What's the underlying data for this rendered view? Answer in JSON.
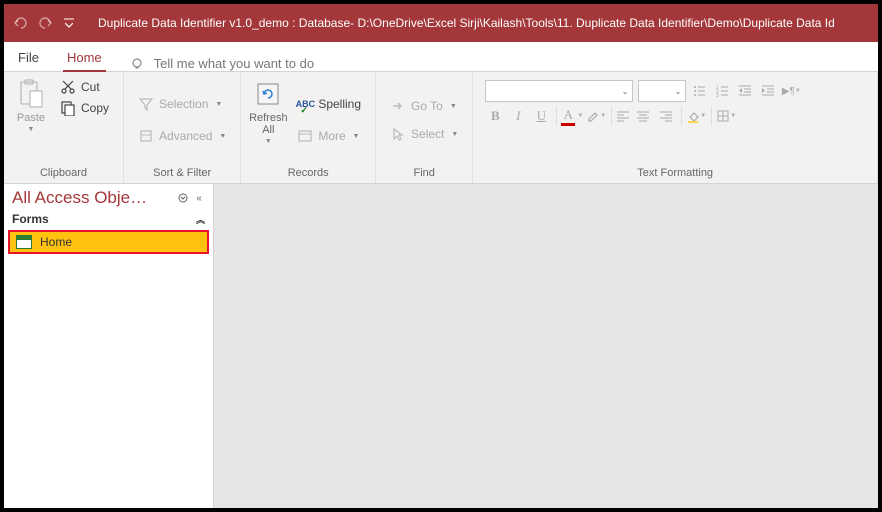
{
  "titlebar": {
    "title": "Duplicate Data Identifier v1.0_demo : Database- D:\\OneDrive\\Excel Sirji\\Kailash\\Tools\\11. Duplicate Data Identifier\\Demo\\Duplicate Data Id"
  },
  "tabs": {
    "file": "File",
    "home": "Home",
    "tellme_placeholder": "Tell me what you want to do"
  },
  "ribbon": {
    "clipboard": {
      "label": "Clipboard",
      "paste": "Paste",
      "cut": "Cut",
      "copy": "Copy"
    },
    "sortfilter": {
      "label": "Sort & Filter",
      "selection": "Selection",
      "advanced": "Advanced"
    },
    "records": {
      "label": "Records",
      "refresh": "Refresh\nAll",
      "spelling": "Spelling",
      "more": "More"
    },
    "find": {
      "label": "Find",
      "goto": "Go To",
      "select": "Select"
    },
    "textfmt": {
      "label": "Text Formatting"
    }
  },
  "nav": {
    "title": "All Access Obje…",
    "group": "Forms",
    "items": [
      {
        "label": "Home"
      }
    ]
  }
}
